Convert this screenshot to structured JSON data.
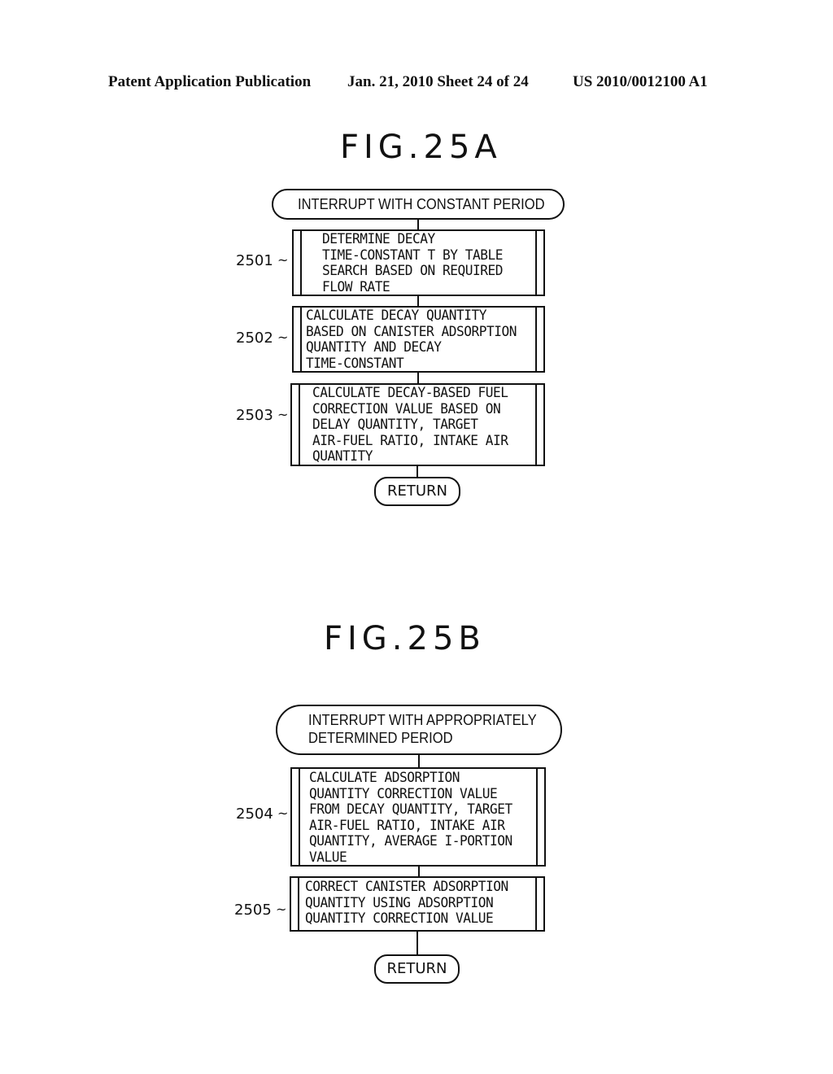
{
  "header": {
    "publication": "Patent Application Publication",
    "date_sheet": "Jan. 21, 2010  Sheet 24 of 24",
    "patent_number": "US 2010/0012100 A1"
  },
  "fig_a": {
    "title": "FIG.25A",
    "start": "INTERRUPT WITH CONSTANT PERIOD",
    "steps": [
      {
        "ref": "2501",
        "text": "DETERMINE DECAY\nTIME-CONSTANT T BY TABLE\nSEARCH BASED ON REQUIRED\nFLOW RATE"
      },
      {
        "ref": "2502",
        "text": "CALCULATE DECAY QUANTITY\nBASED ON CANISTER ADSORPTION\nQUANTITY AND DECAY\nTIME-CONSTANT"
      },
      {
        "ref": "2503",
        "text": "CALCULATE DECAY-BASED FUEL\nCORRECTION VALUE BASED ON\nDELAY QUANTITY, TARGET\nAIR-FUEL RATIO, INTAKE AIR\nQUANTITY"
      }
    ],
    "end": "RETURN"
  },
  "fig_b": {
    "title": "FIG.25B",
    "start": "INTERRUPT WITH APPROPRIATELY\nDETERMINED PERIOD",
    "steps": [
      {
        "ref": "2504",
        "text": "CALCULATE ADSORPTION\nQUANTITY CORRECTION VALUE\nFROM DECAY QUANTITY, TARGET\nAIR-FUEL RATIO, INTAKE AIR\nQUANTITY, AVERAGE I-PORTION\nVALUE"
      },
      {
        "ref": "2505",
        "text": "CORRECT CANISTER ADSORPTION\nQUANTITY USING ADSORPTION\nQUANTITY CORRECTION VALUE"
      }
    ],
    "end": "RETURN"
  },
  "leader_glyph": "~"
}
